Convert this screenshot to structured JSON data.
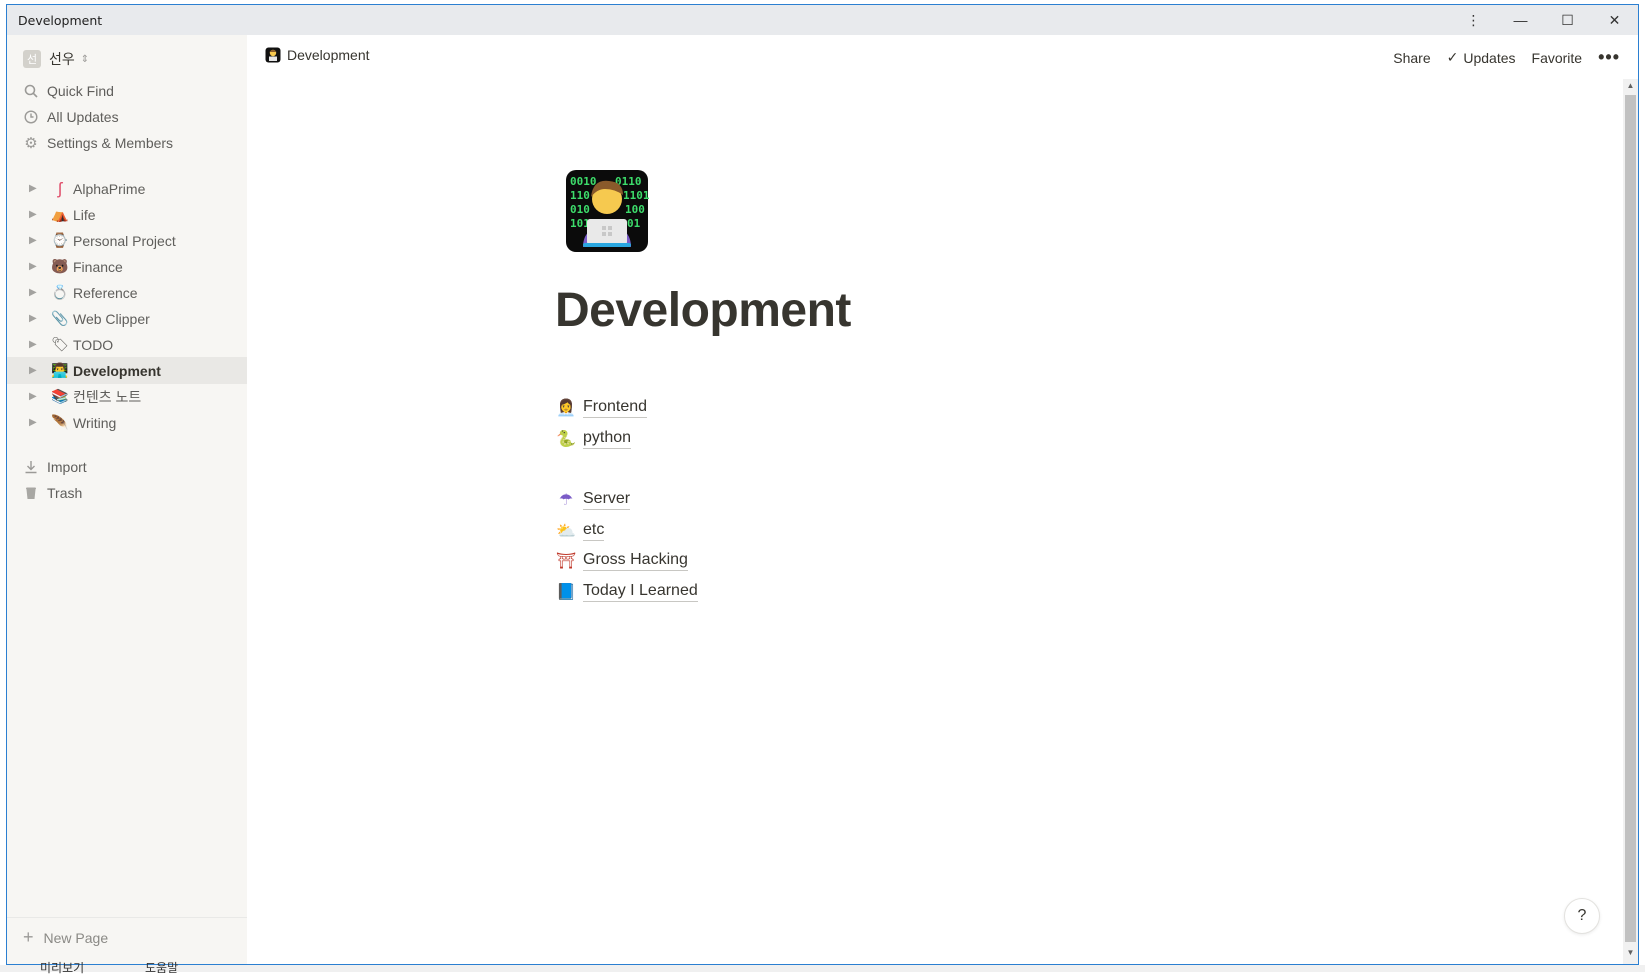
{
  "window": {
    "title": "Development"
  },
  "sidebar": {
    "workspace": {
      "avatar": "선",
      "name": "선우"
    },
    "nav": [
      {
        "label": "Quick Find",
        "icon": "search-icon"
      },
      {
        "label": "All Updates",
        "icon": "clock-icon"
      },
      {
        "label": "Settings & Members",
        "icon": "gear-icon"
      }
    ],
    "pages": [
      {
        "label": "AlphaPrime",
        "emoji": "ʃ"
      },
      {
        "label": "Life",
        "emoji": "⛺"
      },
      {
        "label": "Personal Project",
        "emoji": "⌚"
      },
      {
        "label": "Finance",
        "emoji": "🐻"
      },
      {
        "label": "Reference",
        "emoji": "💍"
      },
      {
        "label": "Web Clipper",
        "emoji": "📎"
      },
      {
        "label": "TODO",
        "emoji": "🏷"
      },
      {
        "label": "Development",
        "emoji": "👨‍💻"
      },
      {
        "label": "컨텐츠 노트",
        "emoji": "📚"
      },
      {
        "label": "Writing",
        "emoji": "🪶"
      }
    ],
    "footer": [
      {
        "label": "Import",
        "icon": "download-icon"
      },
      {
        "label": "Trash",
        "icon": "trash-icon"
      }
    ],
    "new_page": "New Page"
  },
  "topbar": {
    "breadcrumb": "Development",
    "share": "Share",
    "updates": "Updates",
    "favorite": "Favorite",
    "more": "•••"
  },
  "page": {
    "title": "Development",
    "links": [
      {
        "label": "Frontend",
        "emoji": "👩‍💼"
      },
      {
        "label": "python",
        "emoji": "🐍"
      },
      {
        "label": "Server",
        "emoji": "☂"
      },
      {
        "label": "etc",
        "emoji": "⛅"
      },
      {
        "label": "Gross Hacking",
        "emoji": "⛩"
      },
      {
        "label": "Today I Learned",
        "emoji": "📘"
      }
    ]
  },
  "help": "?",
  "taskbar": {
    "left": "미리보기",
    "right": "도움말"
  }
}
